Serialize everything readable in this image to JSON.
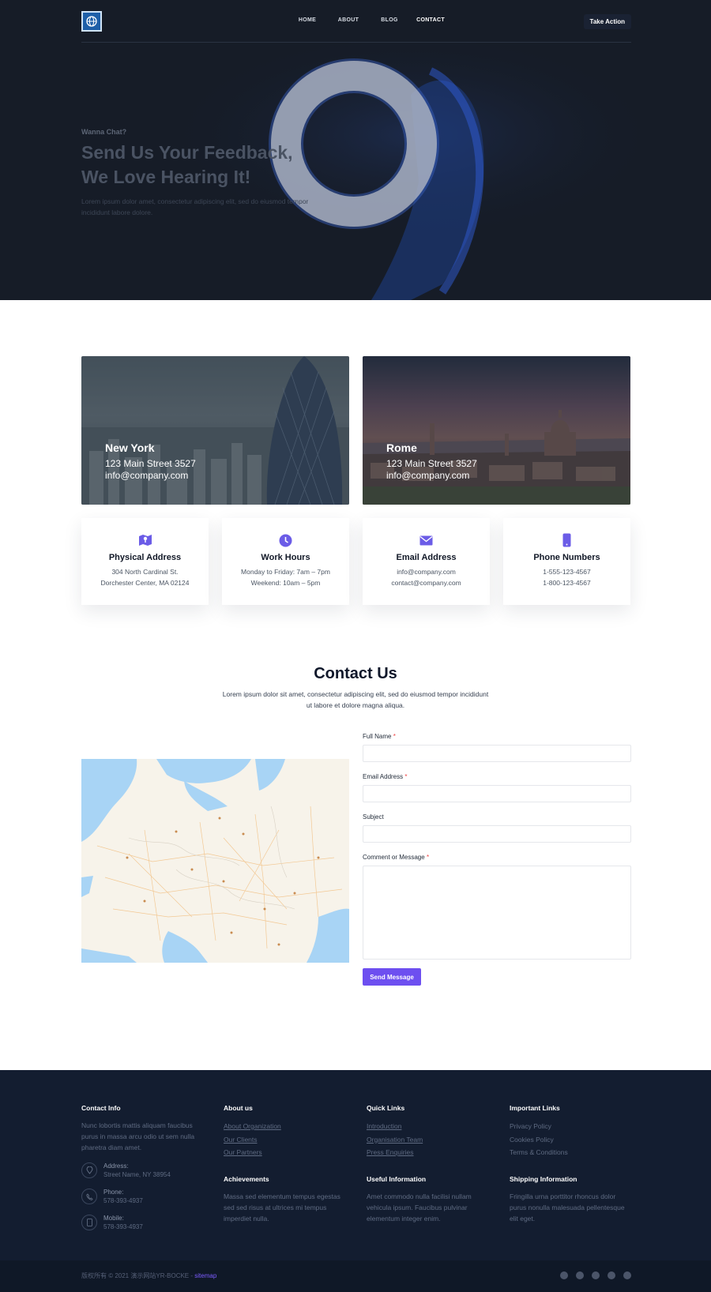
{
  "nav": {
    "links": [
      "HOME",
      "ABOUT",
      "BLOG",
      "CONTACT"
    ],
    "cta": "Take Action"
  },
  "hero": {
    "eyebrow": "Wanna Chat?",
    "title_line1": "Send Us Your Feedback,",
    "title_line2": "We Love Hearing It!",
    "desc_line1": "Lorem ipsum dolor amet, consectetur adipiscing elit, sed do eiusmod tempor",
    "desc_line2": "incididunt labore dolore."
  },
  "cities": [
    {
      "name": "New York",
      "address": "123 Main Street 3527",
      "email": "info@company.com"
    },
    {
      "name": "Rome",
      "address": "123 Main Street 3527",
      "email": "info@company.com"
    }
  ],
  "info_cards": [
    {
      "icon": "map-icon",
      "title": "Physical Address",
      "line1": "304 North Cardinal St.",
      "line2": "Dorchester Center, MA 02124"
    },
    {
      "icon": "clock-icon",
      "title": "Work Hours",
      "line1": "Monday to Friday: 7am – 7pm",
      "line2": "Weekend: 10am – 5pm"
    },
    {
      "icon": "envelope-icon",
      "title": "Email Address",
      "line1": "info@company.com",
      "line2": "contact@company.com"
    },
    {
      "icon": "phone-icon",
      "title": "Phone Numbers",
      "line1": "1-555-123-4567",
      "line2": "1-800-123-4567"
    }
  ],
  "contact": {
    "title": "Contact Us",
    "desc_line1": "Lorem ipsum dolor sit amet, consectetur adipiscing elit, sed do eiusmod tempor incididunt",
    "desc_line2": "ut labore et dolore magna aliqua.",
    "fields": {
      "full_name": "Full Name",
      "email": "Email Address",
      "subject": "Subject",
      "message": "Comment or Message"
    },
    "required_mark": "*",
    "send": "Send Message"
  },
  "footer": {
    "contact_info": {
      "title": "Contact Info",
      "text": "Nunc lobortis mattis aliquam faucibus purus in massa arcu odio ut sem nulla pharetra diam amet.",
      "address_label": "Address:",
      "address": "Street Name, NY 38954",
      "phone_label": "Phone:",
      "phone": "578-393-4937",
      "mobile_label": "Mobile:",
      "mobile": "578-393-4937"
    },
    "about": {
      "title": "About us",
      "links": [
        "About Organization",
        "Our Clients",
        "Our Partners"
      ]
    },
    "quick": {
      "title": "Quick Links",
      "links": [
        "Introduction",
        "Organisation Team",
        "Press Enquiries"
      ]
    },
    "important": {
      "title": "Important Links",
      "links": [
        "Privacy Policy",
        "Cookies Policy",
        "Terms & Conditions"
      ]
    },
    "achievements": {
      "title": "Achievements",
      "text": "Massa sed elementum tempus egestas sed sed risus at ultrices mi tempus imperdiet nulla."
    },
    "useful": {
      "title": "Useful Information",
      "text": "Amet commodo nulla facilisi nullam vehicula ipsum. Faucibus pulvinar elementum integer enim."
    },
    "shipping": {
      "title": "Shipping Information",
      "text": "Fringilla urna porttitor rhoncus dolor purus nonulla malesuada pellentesque elit eget."
    },
    "copyright": "版权所有 © 2021 演示网站YR-BOCKE - ",
    "sitemap": "sitemap",
    "socials": [
      "facebook-icon",
      "twitter-icon",
      "instagram-icon",
      "dribbble-icon",
      "slack-icon"
    ]
  }
}
